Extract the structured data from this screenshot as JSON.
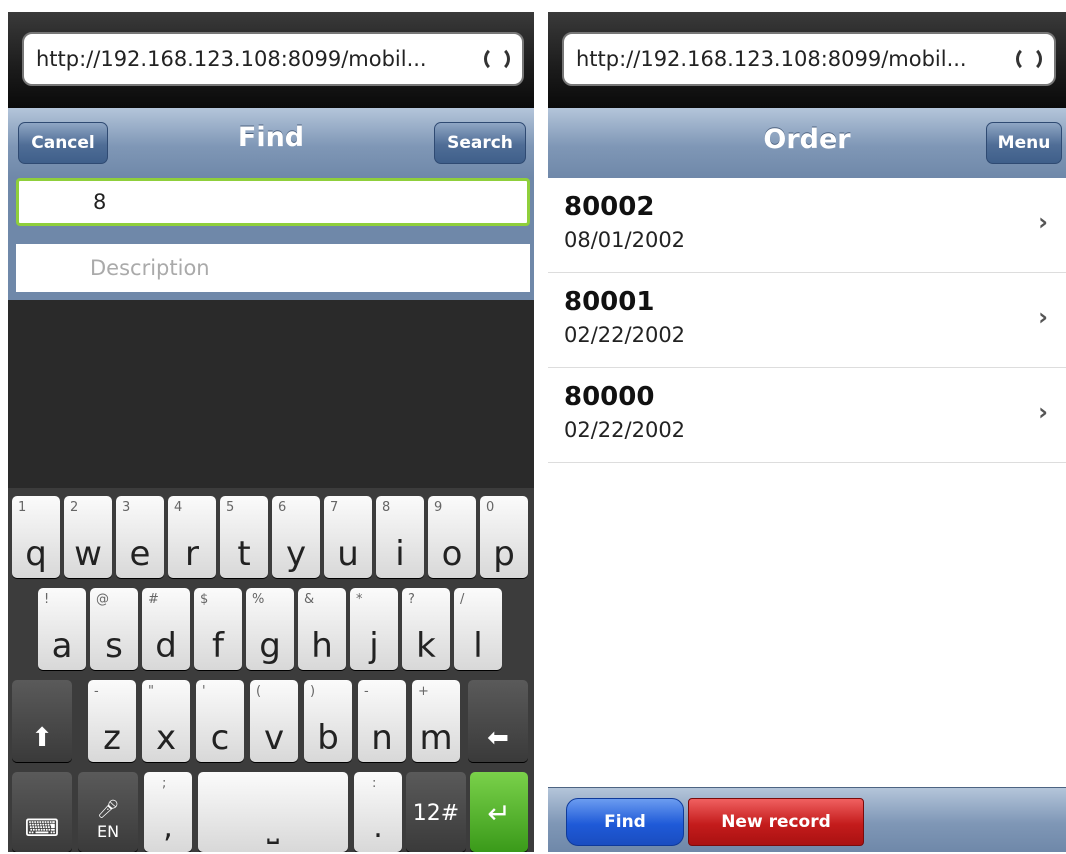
{
  "left": {
    "url": "http://192.168.123.108:8099/mobil...",
    "nav": {
      "cancel": "Cancel",
      "title": "Find",
      "search": "Search"
    },
    "fields": {
      "value": "8",
      "description_placeholder": "Description"
    },
    "keyboard": {
      "row1": [
        [
          "1",
          "q"
        ],
        [
          "2",
          "w"
        ],
        [
          "3",
          "e"
        ],
        [
          "4",
          "r"
        ],
        [
          "5",
          "t"
        ],
        [
          "6",
          "y"
        ],
        [
          "7",
          "u"
        ],
        [
          "8",
          "i"
        ],
        [
          "9",
          "o"
        ],
        [
          "0",
          "p"
        ]
      ],
      "row2": [
        [
          "!",
          "a"
        ],
        [
          "@",
          "s"
        ],
        [
          "#",
          "d"
        ],
        [
          "$",
          "f"
        ],
        [
          "%",
          "g"
        ],
        [
          "&",
          "h"
        ],
        [
          "*",
          "j"
        ],
        [
          "?",
          "k"
        ],
        [
          "/",
          "l"
        ]
      ],
      "row3": [
        [
          "-",
          "z"
        ],
        [
          "\"",
          "x"
        ],
        [
          "'",
          "c"
        ],
        [
          "(",
          "v"
        ],
        [
          ")",
          "b"
        ],
        [
          "-",
          "n"
        ],
        [
          "+",
          "m"
        ]
      ],
      "mic_label": "EN",
      "sym": "12#"
    }
  },
  "right": {
    "url": "http://192.168.123.108:8099/mobil...",
    "nav": {
      "title": "Order",
      "menu": "Menu"
    },
    "orders": [
      {
        "number": "80002",
        "date": "08/01/2002"
      },
      {
        "number": "80001",
        "date": "02/22/2002"
      },
      {
        "number": "80000",
        "date": "02/22/2002"
      }
    ],
    "footer": {
      "find": "Find",
      "new_record": "New record"
    }
  }
}
